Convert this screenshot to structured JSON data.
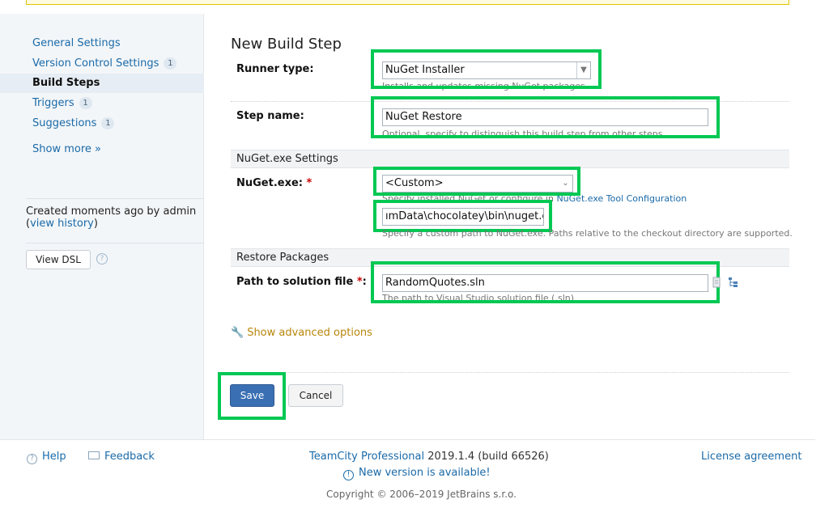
{
  "sidebar": {
    "items": [
      {
        "label": "General Settings",
        "badge": ""
      },
      {
        "label": "Version Control Settings",
        "badge": "1"
      },
      {
        "label": "Build Steps",
        "badge": ""
      },
      {
        "label": "Triggers",
        "badge": "1"
      },
      {
        "label": "Suggestions",
        "badge": "1"
      }
    ],
    "show_more": "Show more »",
    "created_prefix": "Created moments ago by admin",
    "view_history": "view history",
    "view_dsl": "View DSL",
    "help_glyph": "?"
  },
  "form": {
    "title": "New Build Step",
    "runner_type_label": "Runner type:",
    "runner_type_value": "NuGet Installer",
    "runner_type_hint": "Installs and updates missing NuGet packages",
    "step_name_label": "Step name:",
    "step_name_value": "NuGet Restore",
    "step_name_hint": "Optional, specify to distinguish this build step from other steps.",
    "nuget_section": "NuGet.exe Settings",
    "nuget_exe_label": "NuGet.exe:",
    "nuget_exe_value": "<Custom>",
    "nuget_exe_hint_prefix": "Specify installed NuGet or configure in",
    "nuget_exe_hint_link": "NuGet.exe Tool Configuration",
    "nuget_path_value": "ımData\\chocolatey\\bin\\nuget.exe",
    "nuget_path_hint": "Specify a custom path to NuGet.exe. Paths relative to the checkout directory are supported.",
    "restore_section": "Restore Packages",
    "solution_label": "Path to solution file",
    "solution_value": "RandomQuotes.sln",
    "solution_hint": "The path to Visual Studio solution file (.sln)",
    "advanced": "Show advanced options",
    "save": "Save",
    "cancel": "Cancel",
    "required_mark": "*",
    "colon": ":"
  },
  "footer": {
    "help": "Help",
    "feedback": "Feedback",
    "product": "TeamCity Professional",
    "version": "2019.1.4 (build 66526)",
    "new_version": "New version is available!",
    "copyright": "Copyright © 2006–2019 JetBrains s.r.o.",
    "license": "License agreement"
  },
  "colors": {
    "highlight": "#00c853",
    "link": "#1a6aa8",
    "save_button": "#3a6fb3"
  }
}
